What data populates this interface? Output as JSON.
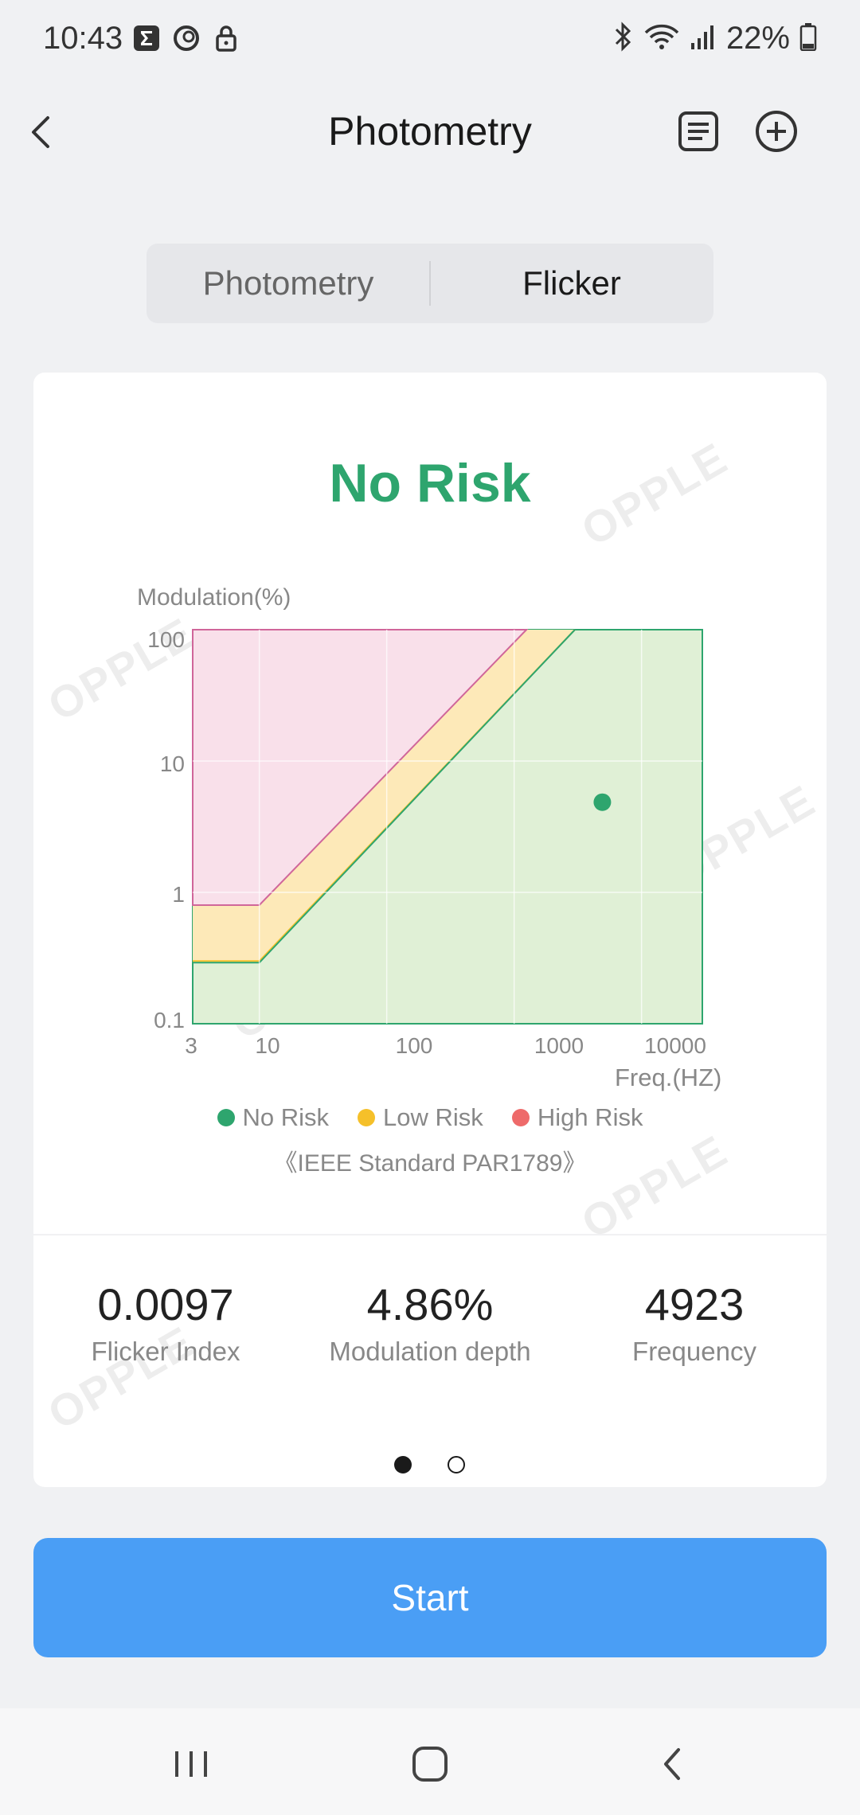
{
  "status_bar": {
    "time": "10:43",
    "battery": "22%",
    "left_icons": [
      "sigma-icon",
      "c-app-icon",
      "lock-icon"
    ],
    "right_icons": [
      "bluetooth-icon",
      "wifi-icon",
      "signal-icon",
      "battery-icon"
    ]
  },
  "header": {
    "title": "Photometry",
    "icons": [
      "back-icon",
      "document-icon",
      "add-circle-icon"
    ]
  },
  "tabs": [
    {
      "label": "Photometry",
      "selected": false
    },
    {
      "label": "Flicker",
      "selected": true
    }
  ],
  "result": {
    "label": "No Risk",
    "color": "#2ea56e"
  },
  "watermark_text": "OPPLE",
  "chart_data": {
    "type": "area",
    "ylabel": "Modulation(%)",
    "xlabel": "Freq.(HZ)",
    "x_scale": "log",
    "y_scale": "log",
    "xlim": [
      3,
      30000
    ],
    "ylim": [
      0.1,
      100
    ],
    "x_ticks": [
      "3",
      "10",
      "100",
      "1000",
      "10000"
    ],
    "y_ticks": [
      "100",
      "10",
      "1",
      "0.1"
    ],
    "regions": [
      {
        "name": "High Risk",
        "color": "#e86a6a",
        "fill": "#f9e0ea",
        "boundary": [
          [
            3,
            0.8
          ],
          [
            10,
            0.8
          ],
          [
            1250,
            100
          ]
        ]
      },
      {
        "name": "Low Risk",
        "color": "#f5c02a",
        "fill": "#fde9b8",
        "boundary": [
          [
            3,
            0.3
          ],
          [
            10,
            0.3
          ],
          [
            3000,
            100
          ]
        ]
      },
      {
        "name": "No Risk",
        "color": "#2ea56e",
        "fill": "#e0f0d6",
        "boundary": [
          [
            3,
            0.1
          ],
          [
            30000,
            0.1
          ]
        ]
      }
    ],
    "point": {
      "x": 4923,
      "y": 4.86,
      "color": "#2ea56e"
    },
    "grid": true,
    "legend": [
      {
        "label": "No Risk",
        "color": "#2ea56e"
      },
      {
        "label": "Low Risk",
        "color": "#f5c02a"
      },
      {
        "label": "High Risk",
        "color": "#ee6a6a"
      }
    ],
    "legend_position": "bottom",
    "caption": "《IEEE Standard PAR1789》"
  },
  "stats": [
    {
      "value": "0.0097",
      "label": "Flicker Index"
    },
    {
      "value": "4.86%",
      "label": "Modulation depth"
    },
    {
      "value": "4923",
      "label": "Frequency"
    }
  ],
  "pager": {
    "pages": 2,
    "current": 1
  },
  "start_button": {
    "label": "Start",
    "color": "#4a9ef5"
  },
  "navbar": {
    "icons": [
      "recent-apps-icon",
      "home-icon",
      "back-nav-icon"
    ]
  }
}
